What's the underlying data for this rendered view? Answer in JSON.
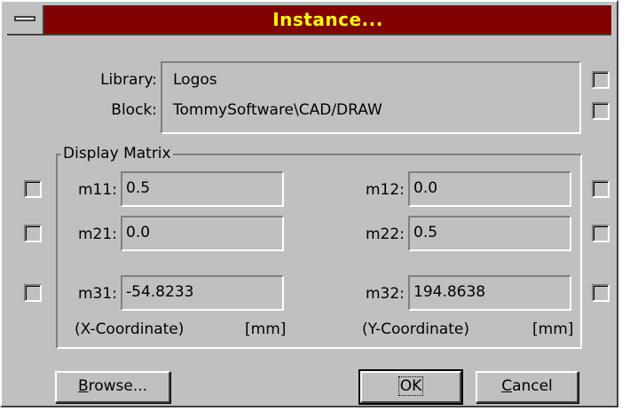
{
  "window": {
    "title": "Instance..."
  },
  "library": {
    "label": "Library:",
    "value": "Logos"
  },
  "block": {
    "label": "Block:",
    "value": "TommySoftware\\CAD/DRAW"
  },
  "matrix": {
    "group_label": "Display Matrix",
    "m11": {
      "label": "m11:",
      "value": "0.5"
    },
    "m12": {
      "label": "m12:",
      "value": "0.0"
    },
    "m21": {
      "label": "m21:",
      "value": "0.0"
    },
    "m22": {
      "label": "m22:",
      "value": "0.5"
    },
    "m31": {
      "label": "m31:",
      "value": "-54.8233"
    },
    "m32": {
      "label": "m32:",
      "value": "194.8638"
    },
    "x_note": "(X-Coordinate)",
    "x_unit": "[mm]",
    "y_note": "(Y-Coordinate)",
    "y_unit": "[mm]"
  },
  "buttons": {
    "browse_first": "B",
    "browse_rest": "rowse...",
    "ok": "OK",
    "cancel_first": "C",
    "cancel_rest": "ancel"
  },
  "colors": {
    "titlebar": "#800000",
    "title_text": "#ffff00",
    "face": "#c0c0c0"
  }
}
